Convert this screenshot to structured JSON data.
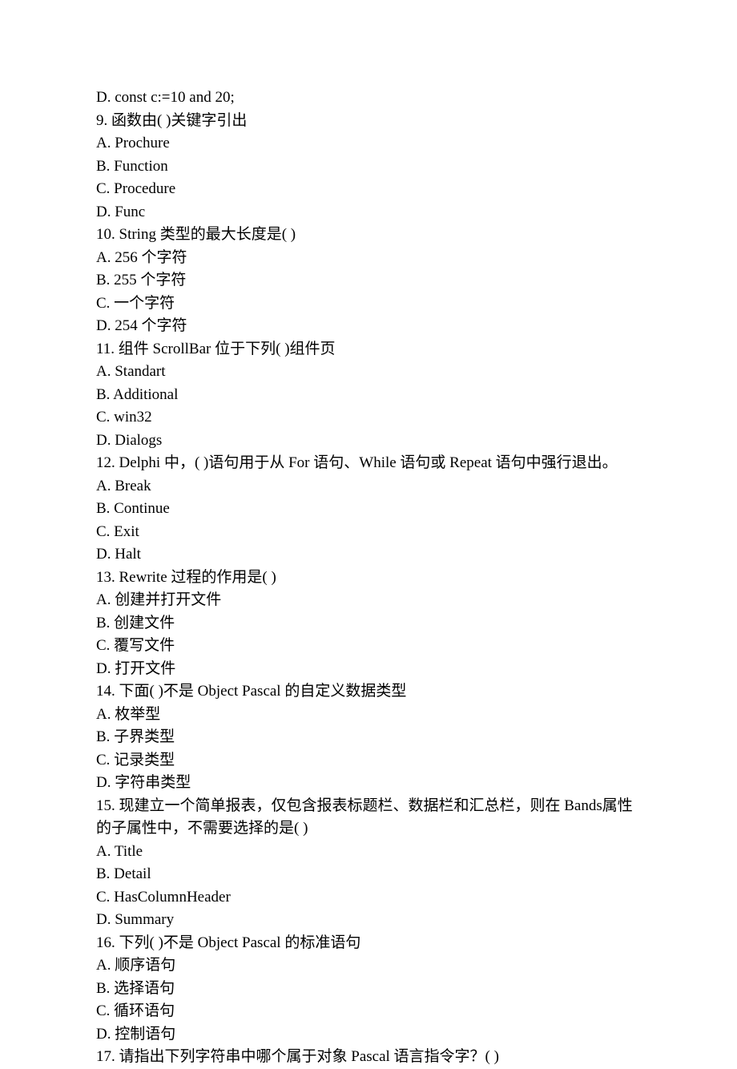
{
  "lines": [
    "D. const c:=10 and 20;",
    "9. 函数由( )关键字引出",
    "A. Prochure",
    "B. Function",
    "C. Procedure",
    "D. Func",
    "10. String 类型的最大长度是( )",
    "A. 256 个字符",
    "B. 255 个字符",
    "C. 一个字符",
    "D. 254 个字符",
    "11. 组件 ScrollBar 位于下列( )组件页",
    "A. Standart",
    "B. Additional",
    "C. win32",
    "D. Dialogs",
    "12. Delphi 中，( )语句用于从 For 语句、While 语句或 Repeat 语句中强行退出。",
    "A. Break",
    "B. Continue",
    "C. Exit",
    "D. Halt",
    "13. Rewrite 过程的作用是( )",
    "A. 创建并打开文件",
    "B. 创建文件",
    "C. 覆写文件",
    "D. 打开文件",
    "14. 下面( )不是 Object Pascal 的自定义数据类型",
    "A. 枚举型",
    "B. 子界类型",
    "C. 记录类型",
    "D. 字符串类型",
    "15. 现建立一个简单报表，仅包含报表标题栏、数据栏和汇总栏，则在 Bands属性的子属性中，不需要选择的是( )",
    "A. Title",
    "B. Detail",
    "C. HasColumnHeader",
    "D. Summary",
    "16. 下列( )不是 Object Pascal 的标准语句",
    "A. 顺序语句",
    "B. 选择语句",
    "C. 循环语句",
    "D. 控制语句",
    "17. 请指出下列字符串中哪个属于对象 Pascal 语言指令字？( )"
  ]
}
